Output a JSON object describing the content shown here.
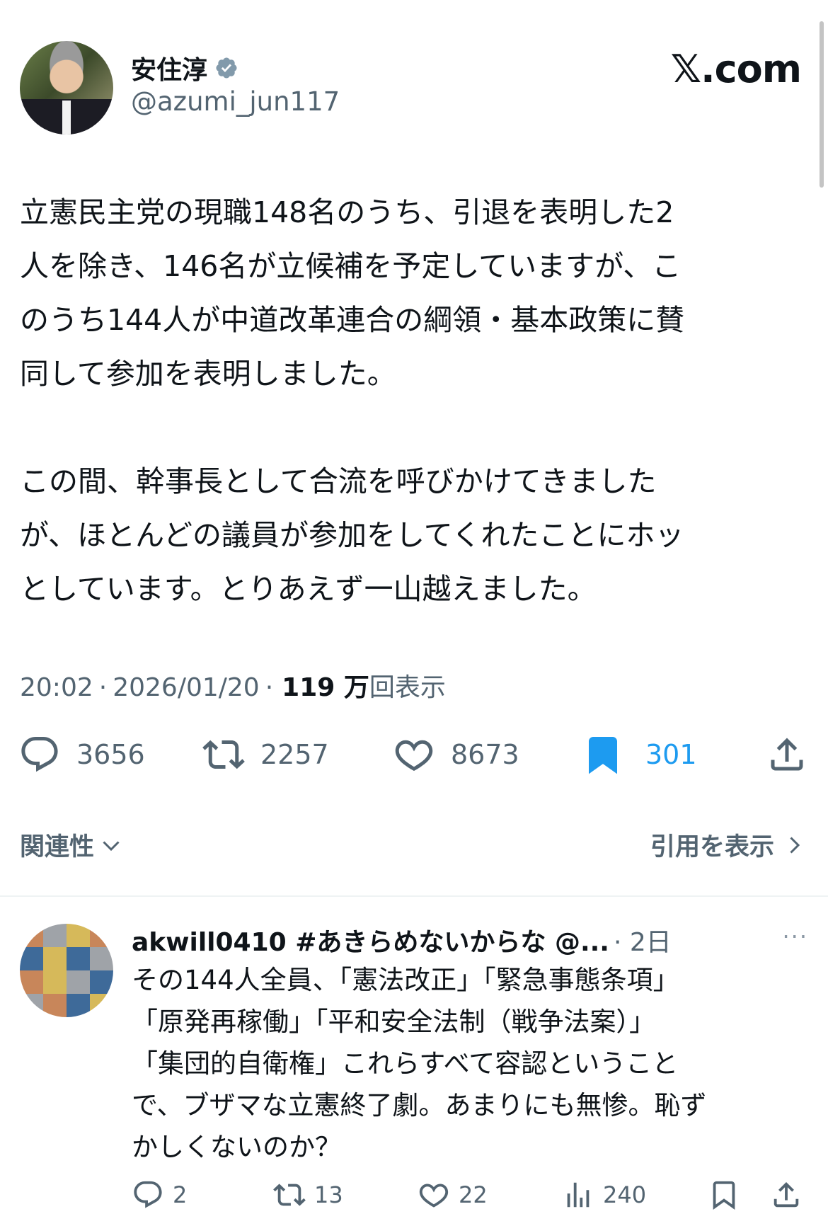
{
  "author": {
    "display_name": "安住淳",
    "handle": "@azumi_jun117",
    "verified_icon": "verified-badge-icon"
  },
  "brand": {
    "text": "𝕏.com"
  },
  "tweet": {
    "text": "立憲民主党の現職148名のうち、引退を表明した2\n人を除き、146名が立候補を予定していますが、こ\nのうち144人が中道改革連合の綱領・基本政策に賛\n同して参加を表明しました。\n\nこの間、幹事長として合流を呼びかけてきました\nが、ほとんどの議員が参加をしてくれたことにホッ\nとしています。とりあえず一山越えました。",
    "time": "20:02",
    "date": "2026/01/20",
    "views_count": "119 万",
    "views_label": "回表示",
    "separator": "·"
  },
  "actions": {
    "replies": "3656",
    "retweets": "2257",
    "likes": "8673",
    "bookmarks": "301"
  },
  "filters": {
    "sort_label": "関連性",
    "quotes_label": "引用を表示"
  },
  "reply": {
    "name": "akwill0410 #あきらめないからな @...",
    "time": "· 2日",
    "more": "···",
    "text": "その144人全員、「憲法改正」「緊急事態条項」\n「原発再稼働」「平和安全法制（戦争法案）」\n「集団的自衛権」これらすべて容認ということ\nで、ブザマな立憲終了劇。あまりにも無惨。恥ず\nかしくないのか？",
    "replies": "2",
    "retweets": "13",
    "likes": "22",
    "views": "240"
  },
  "colors": {
    "accent": "#1d9bf0",
    "muted": "#536471",
    "text": "#0f1419",
    "reply_avatar_tiles": [
      "#c8865a",
      "#9fa3a8",
      "#d6b95a",
      "#c8865a",
      "#3e6a99",
      "#d6b95a",
      "#3e6a99",
      "#9fa3a8",
      "#c8865a",
      "#d6b95a",
      "#9fa3a8",
      "#3e6a99",
      "#9fa3a8",
      "#c8865a",
      "#3e6a99",
      "#d6b95a"
    ]
  }
}
